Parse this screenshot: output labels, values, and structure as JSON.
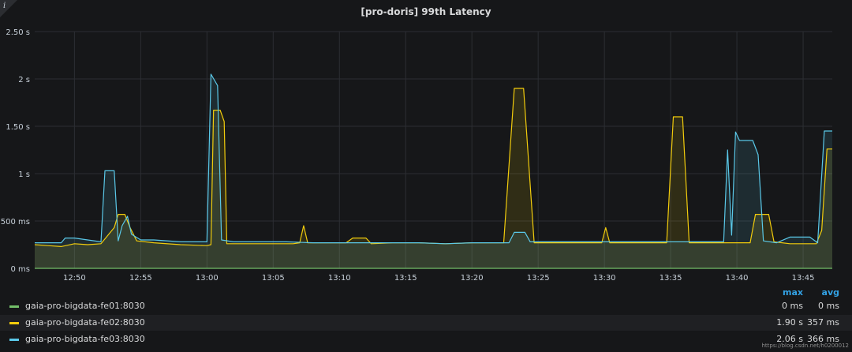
{
  "panel": {
    "title": "[pro-doris] 99th Latency",
    "info_icon": "info-icon",
    "watermark": "https://blog.csdn.net/h0200012"
  },
  "legend": {
    "headers": {
      "max": "max",
      "avg": "avg"
    },
    "items": [
      {
        "name": "gaia-pro-bigdata-fe01:8030",
        "color": "#73bf69",
        "max": "0 ms",
        "avg": "0 ms"
      },
      {
        "name": "gaia-pro-bigdata-fe02:8030",
        "color": "#f2cc0c",
        "max": "1.90 s",
        "avg": "357 ms"
      },
      {
        "name": "gaia-pro-bigdata-fe03:8030",
        "color": "#5ac8e8",
        "max": "2.06 s",
        "avg": "366 ms"
      }
    ]
  },
  "chart_data": {
    "type": "area",
    "title": "[pro-doris] 99th Latency",
    "x_ticks": [
      "12:50",
      "12:55",
      "13:00",
      "13:05",
      "13:10",
      "13:15",
      "13:20",
      "13:25",
      "13:30",
      "13:35",
      "13:40",
      "13:45"
    ],
    "y_ticks": [
      "0 ms",
      "500 ms",
      "1 s",
      "1.50 s",
      "2 s",
      "2.50 s"
    ],
    "xlim_min": [
      47.0,
      107.2
    ],
    "ylim_s": [
      0,
      2.5
    ],
    "grid": true,
    "legend_position": "bottom",
    "x_unit": "minutes after 12:00",
    "series": [
      {
        "name": "gaia-pro-bigdata-fe01:8030",
        "color": "#73bf69",
        "points": [
          [
            47.0,
            0
          ],
          [
            107.2,
            0
          ]
        ]
      },
      {
        "name": "gaia-pro-bigdata-fe02:8030",
        "color": "#f2cc0c",
        "points": [
          [
            47.0,
            0.25
          ],
          [
            48.0,
            0.24
          ],
          [
            49.0,
            0.23
          ],
          [
            50.0,
            0.26
          ],
          [
            51.0,
            0.25
          ],
          [
            52.0,
            0.26
          ],
          [
            53.0,
            0.43
          ],
          [
            53.3,
            0.57
          ],
          [
            53.8,
            0.57
          ],
          [
            54.2,
            0.43
          ],
          [
            54.7,
            0.29
          ],
          [
            56.0,
            0.27
          ],
          [
            58.0,
            0.25
          ],
          [
            60.0,
            0.24
          ],
          [
            60.3,
            0.25
          ],
          [
            60.5,
            1.67
          ],
          [
            61.0,
            1.67
          ],
          [
            61.3,
            1.55
          ],
          [
            61.5,
            0.26
          ],
          [
            63.0,
            0.26
          ],
          [
            65.0,
            0.26
          ],
          [
            66.5,
            0.26
          ],
          [
            67.0,
            0.27
          ],
          [
            67.3,
            0.45
          ],
          [
            67.6,
            0.27
          ],
          [
            69.0,
            0.27
          ],
          [
            70.5,
            0.27
          ],
          [
            71.0,
            0.32
          ],
          [
            72.0,
            0.32
          ],
          [
            72.4,
            0.26
          ],
          [
            74.0,
            0.27
          ],
          [
            76.0,
            0.27
          ],
          [
            78.0,
            0.26
          ],
          [
            80.0,
            0.27
          ],
          [
            82.0,
            0.27
          ],
          [
            82.4,
            0.27
          ],
          [
            83.2,
            1.9
          ],
          [
            83.9,
            1.9
          ],
          [
            84.7,
            0.27
          ],
          [
            86.0,
            0.27
          ],
          [
            88.0,
            0.27
          ],
          [
            89.8,
            0.27
          ],
          [
            90.1,
            0.43
          ],
          [
            90.4,
            0.27
          ],
          [
            92.0,
            0.27
          ],
          [
            94.0,
            0.27
          ],
          [
            94.7,
            0.27
          ],
          [
            95.2,
            1.6
          ],
          [
            95.9,
            1.6
          ],
          [
            96.4,
            0.27
          ],
          [
            98.0,
            0.27
          ],
          [
            100.0,
            0.27
          ],
          [
            101.0,
            0.27
          ],
          [
            101.4,
            0.57
          ],
          [
            102.4,
            0.57
          ],
          [
            102.8,
            0.28
          ],
          [
            104.0,
            0.26
          ],
          [
            106.0,
            0.26
          ],
          [
            106.4,
            0.4
          ],
          [
            106.8,
            1.26
          ],
          [
            107.2,
            1.26
          ]
        ]
      },
      {
        "name": "gaia-pro-bigdata-fe03:8030",
        "color": "#5ac8e8",
        "points": [
          [
            47.0,
            0.27
          ],
          [
            48.0,
            0.27
          ],
          [
            49.0,
            0.27
          ],
          [
            49.3,
            0.32
          ],
          [
            50.0,
            0.32
          ],
          [
            51.0,
            0.3
          ],
          [
            52.0,
            0.28
          ],
          [
            52.3,
            1.03
          ],
          [
            53.0,
            1.03
          ],
          [
            53.3,
            0.29
          ],
          [
            53.6,
            0.45
          ],
          [
            54.0,
            0.55
          ],
          [
            54.3,
            0.36
          ],
          [
            55.0,
            0.3
          ],
          [
            56.0,
            0.3
          ],
          [
            58.0,
            0.28
          ],
          [
            60.0,
            0.28
          ],
          [
            60.3,
            2.05
          ],
          [
            60.8,
            1.93
          ],
          [
            61.1,
            0.3
          ],
          [
            62.0,
            0.28
          ],
          [
            64.0,
            0.28
          ],
          [
            66.0,
            0.28
          ],
          [
            68.0,
            0.27
          ],
          [
            70.0,
            0.27
          ],
          [
            72.0,
            0.27
          ],
          [
            74.0,
            0.27
          ],
          [
            76.0,
            0.27
          ],
          [
            78.0,
            0.26
          ],
          [
            80.0,
            0.27
          ],
          [
            82.0,
            0.27
          ],
          [
            82.8,
            0.27
          ],
          [
            83.2,
            0.38
          ],
          [
            84.0,
            0.38
          ],
          [
            84.4,
            0.28
          ],
          [
            86.0,
            0.28
          ],
          [
            88.0,
            0.28
          ],
          [
            90.0,
            0.28
          ],
          [
            92.0,
            0.28
          ],
          [
            94.0,
            0.28
          ],
          [
            96.0,
            0.28
          ],
          [
            98.0,
            0.28
          ],
          [
            99.0,
            0.28
          ],
          [
            99.3,
            1.25
          ],
          [
            99.6,
            0.35
          ],
          [
            99.9,
            1.44
          ],
          [
            100.2,
            1.35
          ],
          [
            101.2,
            1.35
          ],
          [
            101.6,
            1.2
          ],
          [
            102.0,
            0.29
          ],
          [
            103.0,
            0.27
          ],
          [
            104.0,
            0.33
          ],
          [
            105.5,
            0.33
          ],
          [
            106.1,
            0.27
          ],
          [
            106.6,
            1.45
          ],
          [
            107.2,
            1.45
          ]
        ]
      }
    ]
  }
}
